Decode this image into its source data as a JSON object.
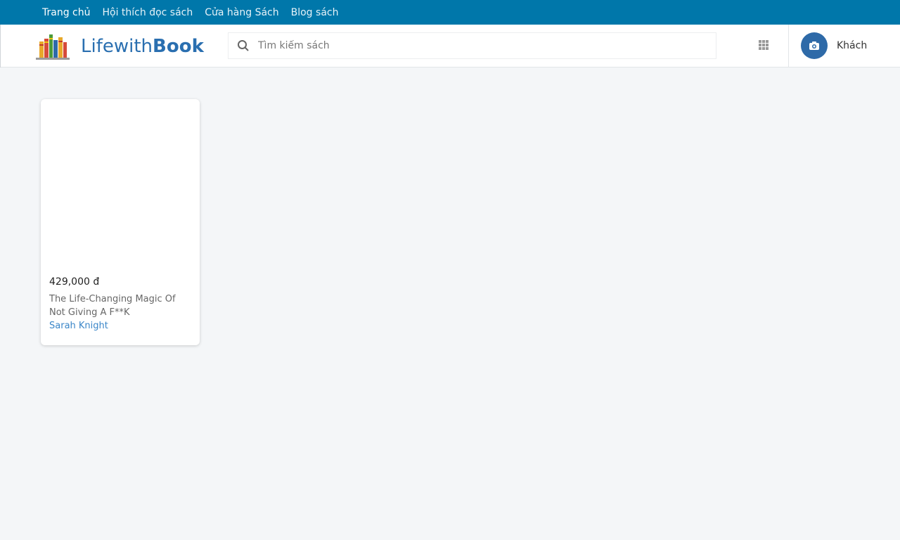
{
  "topnav": {
    "items": [
      {
        "label": "Trang chủ"
      },
      {
        "label": "Hội thích đọc sách"
      },
      {
        "label": "Cửa hàng Sách"
      },
      {
        "label": "Blog sách"
      }
    ]
  },
  "header": {
    "logo_text_light": "Lifewith",
    "logo_text_bold": "Book",
    "search_placeholder": "Tìm kiếm sách",
    "apps_icon": "grid-icon",
    "user_name": "Khách",
    "avatar_icon": "camera-icon"
  },
  "colors": {
    "topnav_bg": "#0077aa",
    "brand": "#2a6fb0",
    "author_link": "#3a86c8",
    "avatar_bg": "#2e6aa8"
  },
  "products": [
    {
      "price": "429,000 đ",
      "title": "The Life-Changing Magic Of Not Giving A F**K",
      "author": "Sarah Knight"
    }
  ]
}
